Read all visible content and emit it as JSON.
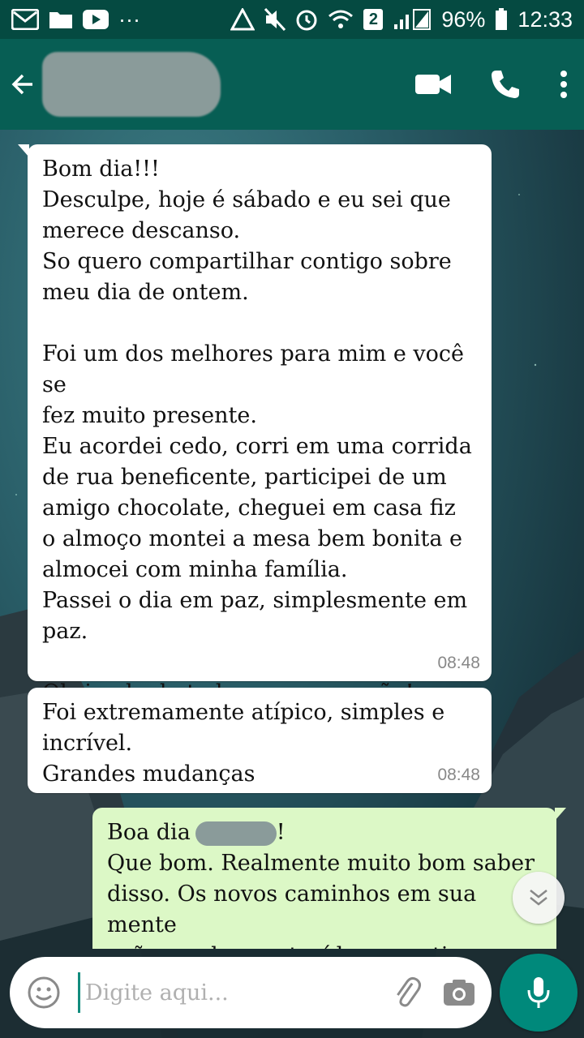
{
  "status_bar": {
    "battery": "96%",
    "time": "12:33",
    "sim_badge": "2",
    "more": "···"
  },
  "header": {
    "contact_name": "",
    "icons": [
      "back-arrow-icon",
      "video-call-icon",
      "phone-icon",
      "more-vert-icon"
    ]
  },
  "messages": [
    {
      "direction": "in",
      "text": "Bom dia!!!\nDesculpe, hoje é sábado e eu sei que\nmerece descanso.\nSo quero compartilhar contigo sobre\nmeu dia de ontem.\n\nFoi um dos melhores para mim e você se\nfez muito presente.\nEu acordei cedo, corri em uma corrida\nde rua beneficente, participei de um\namigo chocolate, cheguei em casa fiz\no almoço montei a mesa bem bonita e\nalmocei com minha família.\nPassei o dia em paz, simplesmente em\npaz.\n\nObrigada de todo o meu coração!",
      "time": "08:48"
    },
    {
      "direction": "in",
      "text": "Foi extremamente atípico, simples e\nincrível.\nGrandes mudanças",
      "time": "08:48"
    },
    {
      "direction": "out",
      "greeting": "Boa dia",
      "greeting_suffix": "!",
      "text": "Que bom. Realmente muito bom saber\ndisso. Os novos caminhos em sua mente\nvaão sendo construídos a partir"
    }
  ],
  "composer": {
    "placeholder": "Digite aqui..."
  },
  "colors": {
    "header": "#075e54",
    "status_bar": "#054a41",
    "incoming_bubble": "#ffffff",
    "outgoing_bubble": "#dcf8c6",
    "accent": "#00897b"
  }
}
